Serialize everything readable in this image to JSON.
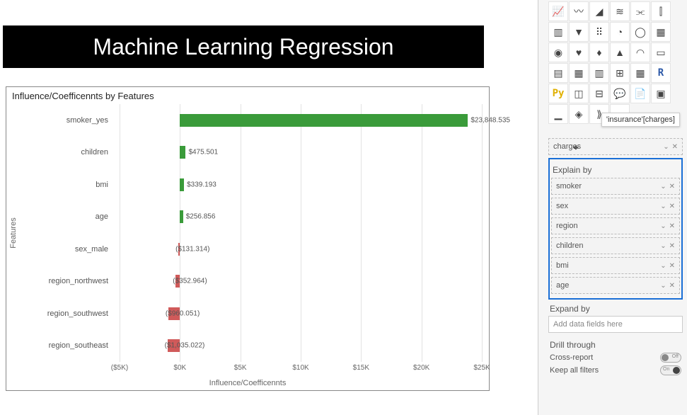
{
  "title_banner": "Machine Learning Regression",
  "chart_title": "Influence/Coefficennts by Features",
  "xaxis_label": "Influence/Coefficennts",
  "yaxis_label": "Features",
  "chart_data": {
    "type": "bar",
    "orientation": "horizontal",
    "categories": [
      "smoker_yes",
      "children",
      "bmi",
      "age",
      "sex_male",
      "region_northwest",
      "region_southwest",
      "region_southeast"
    ],
    "values": [
      23848.535,
      475.501,
      339.193,
      256.856,
      -131.314,
      -352.964,
      -960.051,
      -1035.022
    ],
    "value_labels": [
      "$23,848.535",
      "$475.501",
      "$339.193",
      "$256.856",
      "($131.314)",
      "($352.964)",
      "($960.051)",
      "($1,035.022)"
    ],
    "x_ticks": [
      -5000,
      0,
      5000,
      10000,
      15000,
      20000,
      25000
    ],
    "x_tick_labels": [
      "($5K)",
      "$0K",
      "$5K",
      "$10K",
      "$15K",
      "$20K",
      "$25K"
    ],
    "xlim": [
      -5000,
      25000
    ],
    "title": "Influence/Coefficennts by Features",
    "xlabel": "Influence/Coefficennts",
    "ylabel": "Features",
    "positive_color": "#3a9b3a",
    "negative_color": "#d05a5a"
  },
  "tooltip_text": "'insurance'[charges]",
  "analyze_field": "charges",
  "explain_by_label": "Explain by",
  "explain_by_fields": [
    "smoker",
    "sex",
    "region",
    "children",
    "bmi",
    "age"
  ],
  "expand_by_label": "Expand by",
  "expand_by_placeholder": "Add data fields here",
  "drill_through_label": "Drill through",
  "cross_report_label": "Cross-report",
  "cross_report_state": "Off",
  "keep_filters_label": "Keep all filters",
  "keep_filters_state": "On",
  "viz_icons": [
    "line-chart-icon",
    "area-chart-icon",
    "stacked-area-icon",
    "ribbon-chart-icon",
    "combo-chart-icon",
    "combo-stacked-icon",
    "bar-chart-icon",
    "funnel-icon",
    "scatter-icon",
    "pie-icon",
    "donut-icon",
    "treemap-icon",
    "globe-icon",
    "filled-map-icon",
    "shape-map-icon",
    "azure-map-icon",
    "gauge-icon",
    "kpi-icon",
    "card-icon",
    "multi-card-icon",
    "matrix-icon",
    "table-icon",
    "table2-icon",
    "r-script-icon",
    "python-icon",
    "key-influencer-icon",
    "decomposition-icon",
    "qa-icon",
    "narrative-icon",
    "paginated-icon",
    "sparkline-icon",
    "powerapps-icon",
    "automate-icon",
    "more-icon"
  ]
}
